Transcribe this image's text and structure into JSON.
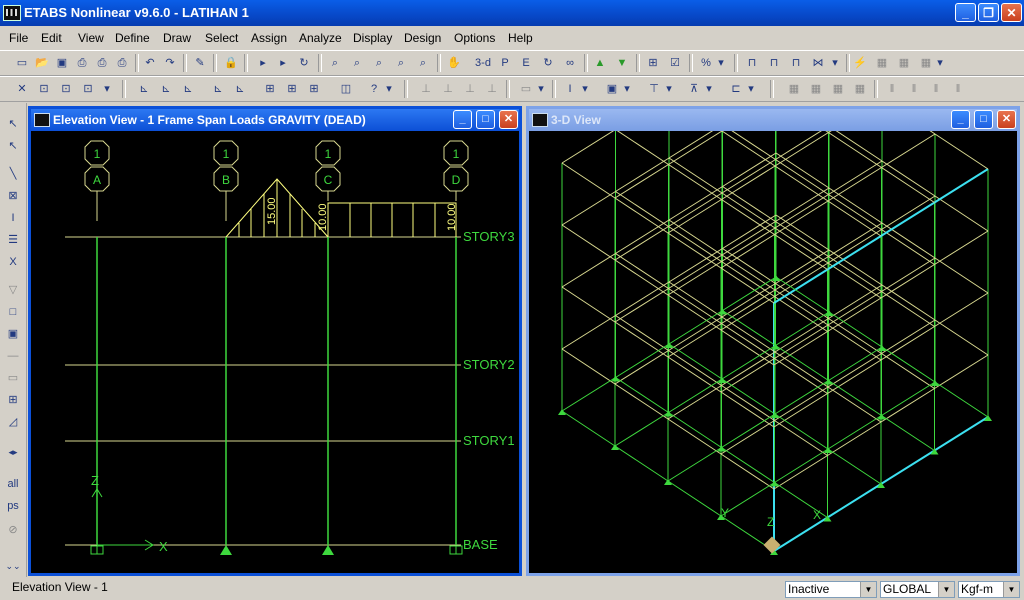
{
  "app": {
    "title": "ETABS Nonlinear v9.6.0 - LATIHAN 1"
  },
  "menu": [
    "File",
    "Edit",
    "View",
    "Define",
    "Draw",
    "Select",
    "Assign",
    "Analyze",
    "Display",
    "Design",
    "Options",
    "Help"
  ],
  "toolbar": {
    "view_3d_label": "3-d"
  },
  "left_toolbar": {
    "all_label": "all",
    "ps_label": "ps"
  },
  "elevation_view": {
    "title": "Elevation View - 1  Frame Span Loads GRAVITY  (DEAD)",
    "grid_bubbles": [
      {
        "row": "1",
        "col": "A"
      },
      {
        "row": "1",
        "col": "B"
      },
      {
        "row": "1",
        "col": "C"
      },
      {
        "row": "1",
        "col": "D"
      }
    ],
    "stories": [
      "STORY3",
      "STORY2",
      "STORY1",
      "BASE"
    ],
    "loads": {
      "triangular": "15.00",
      "uniform_left": "10.00",
      "uniform_right": "10.00"
    },
    "axis_z": "Z",
    "axis_x": "X"
  },
  "view_3d": {
    "title": "3-D View",
    "axis_x": "X",
    "axis_y": "Y",
    "axis_z": "Z"
  },
  "status": {
    "text": "Elevation View - 1",
    "mode": "Inactive",
    "coord_system": "GLOBAL",
    "units": "Kgf-m"
  },
  "colors": {
    "grid_line": "#d8d890",
    "frame_green": "#3ed83e",
    "load_yellow": "#ffff80",
    "highlight_cyan": "#3ce0f0"
  }
}
